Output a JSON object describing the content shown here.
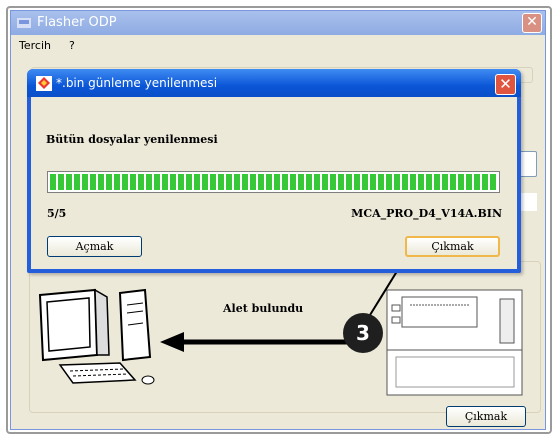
{
  "window": {
    "title": "Flasher ODP",
    "menu": [
      "Tercih",
      "?"
    ],
    "device_status": "Alet bulundu",
    "exit_button": "Çıkmak"
  },
  "dialog": {
    "title": "*.bin günleme yenilenmesi",
    "message": "Bütün dosyalar yenilenmesi",
    "progress_fraction": 1.0,
    "count": "5/5",
    "filename": "MCA_PRO_D4_V14A.BIN",
    "open_button": "Açmak",
    "exit_button": "Çıkmak"
  },
  "annotation": {
    "step": "3"
  },
  "colors": {
    "progress": "#37c837",
    "dialog_title": "#0b56d7",
    "close": "#e0553f"
  }
}
